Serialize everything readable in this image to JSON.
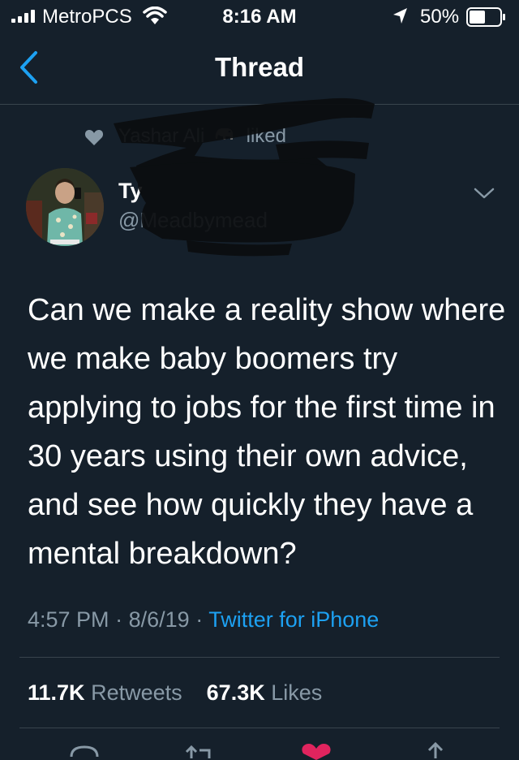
{
  "status_bar": {
    "carrier": "MetroPCS",
    "time": "8:16 AM",
    "battery": "50%"
  },
  "nav": {
    "title": "Thread"
  },
  "social_context": {
    "name": "Yashar Ali",
    "action": "liked"
  },
  "author": {
    "name": "Ty",
    "handle": "@Meadbymead"
  },
  "tweet": {
    "text": "Can we make a reality show where we make baby boomers try applying to jobs for the first time in 30 years using their own advice, and see how quickly they have a mental breakdown?",
    "time": "4:57 PM",
    "date": "8/6/19",
    "sep": "·",
    "source": "Twitter for iPhone"
  },
  "stats": {
    "retweets": "11.7K",
    "retweets_label": "Retweets",
    "likes": "67.3K",
    "likes_label": "Likes"
  },
  "colors": {
    "background": "#15202b",
    "accent": "#1da1f2",
    "secondary_text": "#8899a6",
    "like_red": "#e0245e",
    "divider": "#38444d"
  },
  "icons": [
    "signal-icon",
    "wifi-icon",
    "location-icon",
    "battery-icon",
    "back-chevron-icon",
    "heart-icon",
    "elephant-emoji-icon",
    "chevron-down-icon",
    "reply-icon",
    "retweet-icon",
    "like-icon",
    "share-icon"
  ]
}
